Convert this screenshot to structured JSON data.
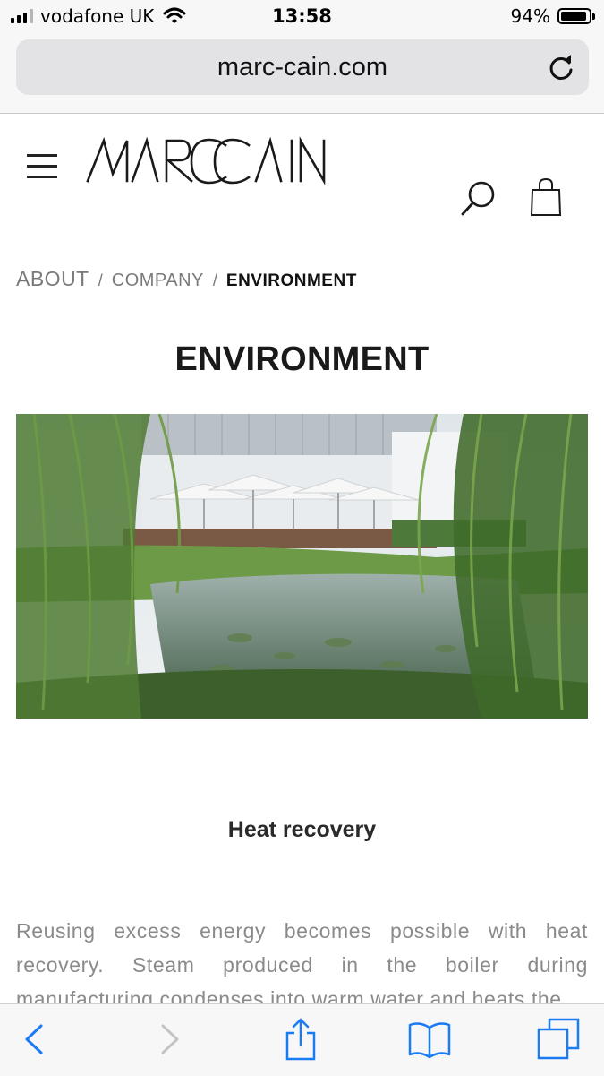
{
  "status_bar": {
    "carrier": "vodafone UK",
    "time": "13:58",
    "battery_percent": "94%",
    "battery_level": 0.94,
    "signal_bars_on": 3,
    "signal_bars_total": 4
  },
  "browser": {
    "url": "marc-cain.com",
    "reload_icon": "reload-icon"
  },
  "header": {
    "logo_text": "MARCCAIN",
    "menu_icon": "hamburger-icon",
    "search_icon": "search-icon",
    "bag_icon": "shopping-bag-icon"
  },
  "breadcrumb": {
    "items": [
      "ABOUT",
      "COMPANY",
      "ENVIRONMENT"
    ],
    "separator": "/"
  },
  "page": {
    "title": "ENVIRONMENT",
    "hero_alt_subject": "building-with-pond-and-willows",
    "section_heading": "Heat recovery",
    "body": "Reusing excess energy becomes possible with heat recovery. Steam produced in the boiler during manufacturing condenses into warm water and heats the"
  },
  "toolbar": {
    "back_icon": "back-chevron-icon",
    "forward_icon": "forward-chevron-icon",
    "share_icon": "share-icon",
    "bookmarks_icon": "bookmarks-icon",
    "tabs_icon": "tabs-icon"
  },
  "colors": {
    "accent_blue": "#1a7cf5",
    "text_dark": "#1a1a1a",
    "text_gray": "#8a8a8a"
  }
}
